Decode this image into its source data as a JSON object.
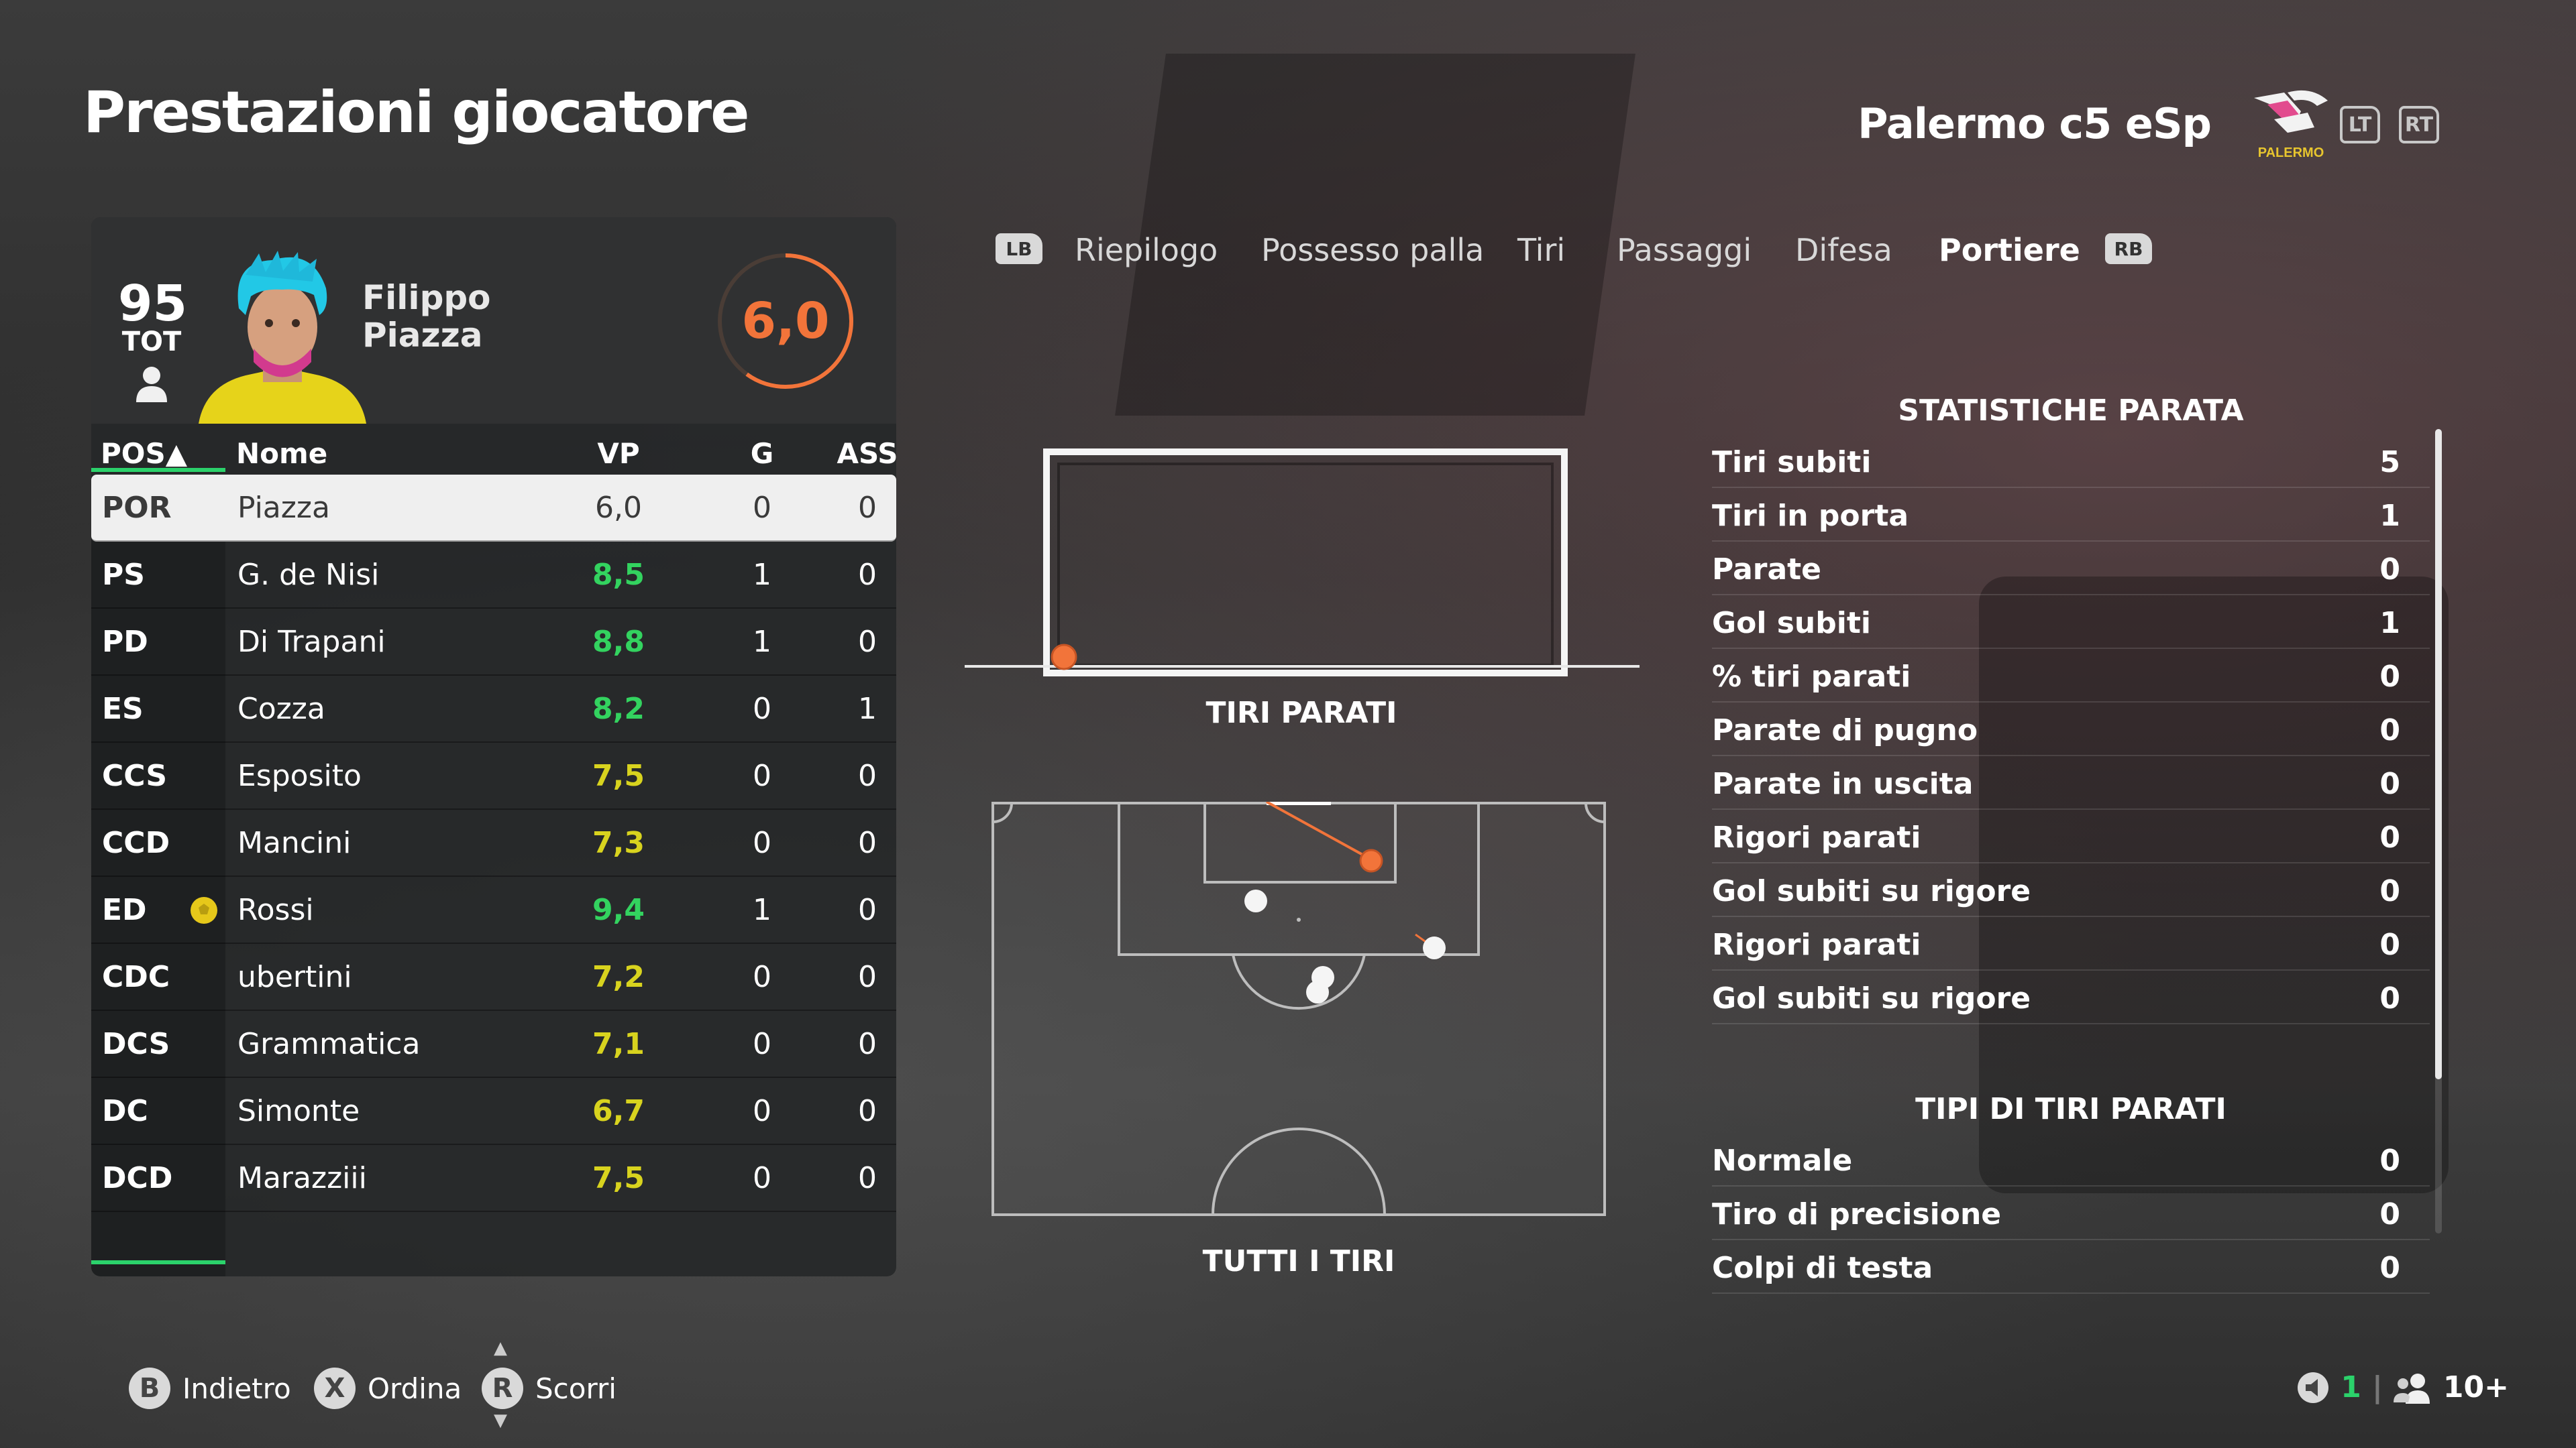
{
  "header": {
    "title": "Prestazioni giocatore",
    "team_name": "Palermo c5 eSp",
    "club_logo_text": "PALERMO",
    "lt_label": "LT",
    "rt_label": "RT"
  },
  "player": {
    "overall": "95",
    "overall_label": "TOT",
    "first_name": "Filippo",
    "last_name": "Piazza",
    "match_rating": "6,0",
    "match_rating_value": 6.0
  },
  "table": {
    "headers": {
      "pos": "POS▲",
      "name": "Nome",
      "vp": "VP",
      "g": "G",
      "ass": "ASS"
    },
    "rows": [
      {
        "pos": "POR",
        "name": "Piazza",
        "vp": "6,0",
        "g": "0",
        "ass": "0"
      },
      {
        "pos": "PS",
        "name": "G. de Nisi",
        "vp": "8,5",
        "g": "1",
        "ass": "0"
      },
      {
        "pos": "PD",
        "name": "Di Trapani",
        "vp": "8,8",
        "g": "1",
        "ass": "0"
      },
      {
        "pos": "ES",
        "name": "Cozza",
        "vp": "8,2",
        "g": "0",
        "ass": "1"
      },
      {
        "pos": "CCS",
        "name": "Esposito",
        "vp": "7,5",
        "g": "0",
        "ass": "0"
      },
      {
        "pos": "CCD",
        "name": "Mancini",
        "vp": "7,3",
        "g": "0",
        "ass": "0"
      },
      {
        "pos": "ED",
        "name": "Rossi",
        "vp": "9,4",
        "g": "1",
        "ass": "0"
      },
      {
        "pos": "CDC",
        "name": "ubertini",
        "vp": "7,2",
        "g": "0",
        "ass": "0"
      },
      {
        "pos": "DCS",
        "name": "Grammatica",
        "vp": "7,1",
        "g": "0",
        "ass": "0"
      },
      {
        "pos": "DC",
        "name": "Simonte",
        "vp": "6,7",
        "g": "0",
        "ass": "0"
      },
      {
        "pos": "DCD",
        "name": "Marazziii",
        "vp": "7,5",
        "g": "0",
        "ass": "0"
      }
    ]
  },
  "tabs": {
    "lb": "LB",
    "rb": "RB",
    "items": [
      "Riepilogo",
      "Possesso palla",
      "Tiri",
      "Passaggi",
      "Difesa",
      "Portiere"
    ],
    "active": "Portiere"
  },
  "visuals": {
    "saved_shots_label": "TIRI PARATI",
    "all_shots_label": "TUTTI I TIRI"
  },
  "stats": {
    "section1_title": "STATISTICHE PARATA",
    "section1": [
      {
        "label": "Tiri subiti",
        "value": "5"
      },
      {
        "label": "Tiri in porta",
        "value": "1"
      },
      {
        "label": "Parate",
        "value": "0"
      },
      {
        "label": "Gol subiti",
        "value": "1"
      },
      {
        "label": "% tiri parati",
        "value": "0"
      },
      {
        "label": "Parate di pugno",
        "value": "0"
      },
      {
        "label": "Parate in uscita",
        "value": "0"
      },
      {
        "label": "Rigori parati",
        "value": "0"
      },
      {
        "label": "Gol subiti su rigore",
        "value": "0"
      },
      {
        "label": "Rigori parati",
        "value": "0"
      },
      {
        "label": "Gol subiti su rigore",
        "value": "0"
      }
    ],
    "section2_title": "TIPI DI TIRI PARATI",
    "section2": [
      {
        "label": "Normale",
        "value": "0"
      },
      {
        "label": "Tiro di precisione",
        "value": "0"
      },
      {
        "label": "Colpi di testa",
        "value": "0"
      }
    ]
  },
  "footer": {
    "back_key": "B",
    "back_label": "Indietro",
    "sort_key": "X",
    "sort_label": "Ordina",
    "scroll_key": "R",
    "scroll_label": "Scorri",
    "status_count": "1",
    "players_count": "10+"
  },
  "colors": {
    "accent_green": "#2bd26b",
    "rating_orange": "#f2743a",
    "vp_green": "#33d35f",
    "vp_yellow": "#d8d31e"
  }
}
